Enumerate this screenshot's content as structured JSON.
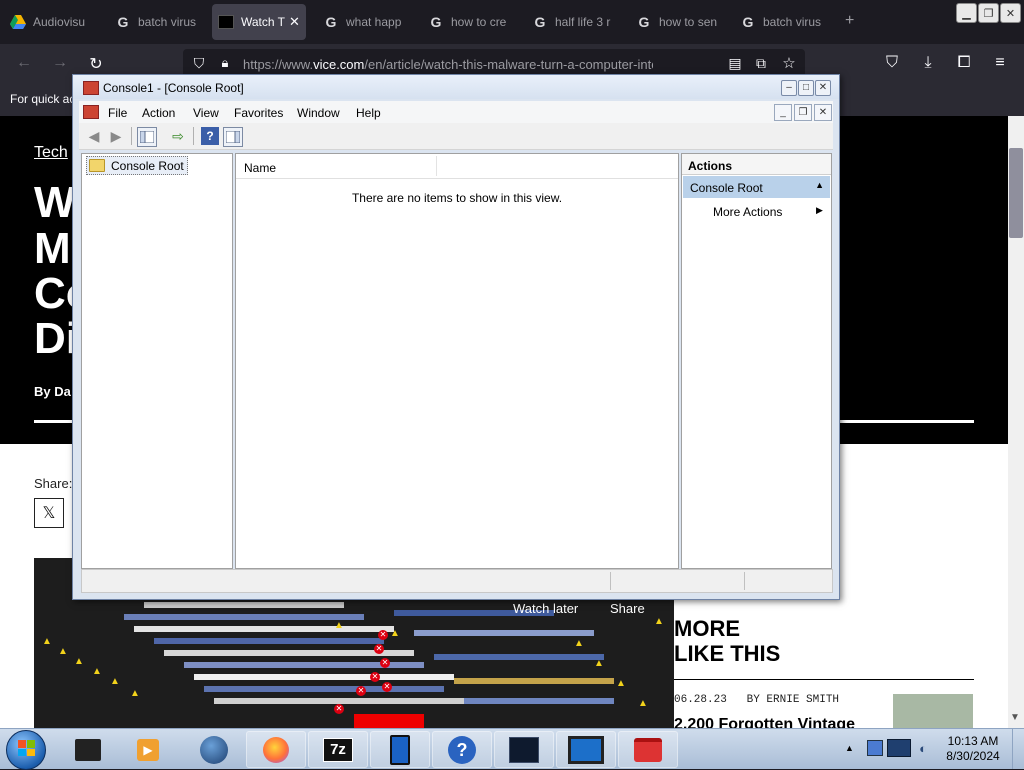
{
  "browser": {
    "tabs": [
      {
        "label": "Audiovisu",
        "icon": "google-drive-icon",
        "active": false
      },
      {
        "label": "batch virus",
        "icon": "google-icon",
        "active": false
      },
      {
        "label": "Watch Th",
        "icon": "vice-icon",
        "active": true
      },
      {
        "label": "what happ",
        "icon": "google-icon",
        "active": false
      },
      {
        "label": "how to cre",
        "icon": "google-icon",
        "active": false
      },
      {
        "label": "half life 3 r",
        "icon": "google-icon",
        "active": false
      },
      {
        "label": "how to sen",
        "icon": "google-icon",
        "active": false
      },
      {
        "label": "batch virus",
        "icon": "google-icon",
        "active": false
      }
    ],
    "url_prefix": "https://www.",
    "url_domain": "vice.com",
    "url_path": "/en/article/watch-this-malware-turn-a-computer-into-a",
    "bookmarks_text": "For quick ac"
  },
  "article": {
    "section": "Tech",
    "headline_lines": [
      "W",
      "M",
      "Co",
      "Di"
    ],
    "byline": "By Da",
    "share_label": "Share:",
    "share_x": "𝕏",
    "video_watch_later": "Watch later",
    "video_share": "Share",
    "more_title_1": "MORE",
    "more_title_2": "LIKE THIS",
    "post_date": "06.28.23   BY ERNIE SMITH",
    "post_title": "2,200 Forgotten Vintage"
  },
  "mmc": {
    "title": "Console1 - [Console Root]",
    "menu": [
      "File",
      "Action",
      "View",
      "Favorites",
      "Window",
      "Help"
    ],
    "tree_root": "Console Root",
    "column_name": "Name",
    "empty_message": "There are no items to show in this view.",
    "actions_header": "Actions",
    "actions_section": "Console Root",
    "more_actions": "More Actions"
  },
  "taskbar": {
    "time": "10:13 AM",
    "date": "8/30/2024",
    "apps": [
      "desktop-app-icon",
      "media-player-icon",
      "globe-icon",
      "firefox-icon",
      "7zip-icon",
      "tablet-icon",
      "help-icon",
      "performance-monitor-icon",
      "remote-desktop-icon",
      "toolbox-icon"
    ]
  },
  "colors": {
    "browser_bg": "#1c1b22",
    "mmc_selected": "#b9d1ea",
    "hero_bg": "#000000"
  }
}
